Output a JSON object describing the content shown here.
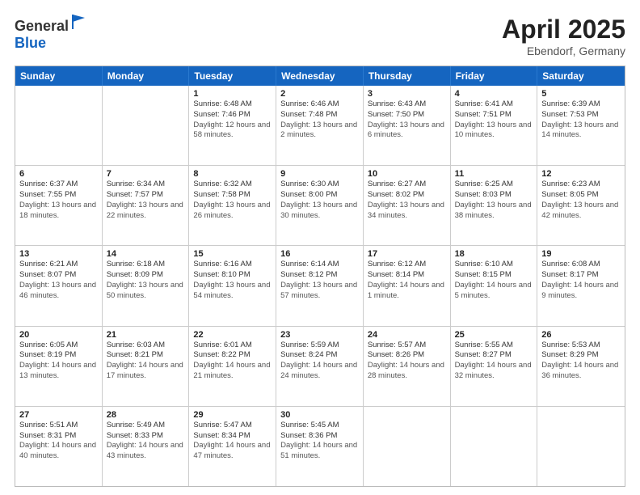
{
  "header": {
    "logo_general": "General",
    "logo_blue": "Blue",
    "month": "April 2025",
    "location": "Ebendorf, Germany"
  },
  "weekdays": [
    "Sunday",
    "Monday",
    "Tuesday",
    "Wednesday",
    "Thursday",
    "Friday",
    "Saturday"
  ],
  "weeks": [
    [
      {
        "day": "",
        "sunrise": "",
        "sunset": "",
        "daylight": ""
      },
      {
        "day": "",
        "sunrise": "",
        "sunset": "",
        "daylight": ""
      },
      {
        "day": "1",
        "sunrise": "Sunrise: 6:48 AM",
        "sunset": "Sunset: 7:46 PM",
        "daylight": "Daylight: 12 hours and 58 minutes."
      },
      {
        "day": "2",
        "sunrise": "Sunrise: 6:46 AM",
        "sunset": "Sunset: 7:48 PM",
        "daylight": "Daylight: 13 hours and 2 minutes."
      },
      {
        "day": "3",
        "sunrise": "Sunrise: 6:43 AM",
        "sunset": "Sunset: 7:50 PM",
        "daylight": "Daylight: 13 hours and 6 minutes."
      },
      {
        "day": "4",
        "sunrise": "Sunrise: 6:41 AM",
        "sunset": "Sunset: 7:51 PM",
        "daylight": "Daylight: 13 hours and 10 minutes."
      },
      {
        "day": "5",
        "sunrise": "Sunrise: 6:39 AM",
        "sunset": "Sunset: 7:53 PM",
        "daylight": "Daylight: 13 hours and 14 minutes."
      }
    ],
    [
      {
        "day": "6",
        "sunrise": "Sunrise: 6:37 AM",
        "sunset": "Sunset: 7:55 PM",
        "daylight": "Daylight: 13 hours and 18 minutes."
      },
      {
        "day": "7",
        "sunrise": "Sunrise: 6:34 AM",
        "sunset": "Sunset: 7:57 PM",
        "daylight": "Daylight: 13 hours and 22 minutes."
      },
      {
        "day": "8",
        "sunrise": "Sunrise: 6:32 AM",
        "sunset": "Sunset: 7:58 PM",
        "daylight": "Daylight: 13 hours and 26 minutes."
      },
      {
        "day": "9",
        "sunrise": "Sunrise: 6:30 AM",
        "sunset": "Sunset: 8:00 PM",
        "daylight": "Daylight: 13 hours and 30 minutes."
      },
      {
        "day": "10",
        "sunrise": "Sunrise: 6:27 AM",
        "sunset": "Sunset: 8:02 PM",
        "daylight": "Daylight: 13 hours and 34 minutes."
      },
      {
        "day": "11",
        "sunrise": "Sunrise: 6:25 AM",
        "sunset": "Sunset: 8:03 PM",
        "daylight": "Daylight: 13 hours and 38 minutes."
      },
      {
        "day": "12",
        "sunrise": "Sunrise: 6:23 AM",
        "sunset": "Sunset: 8:05 PM",
        "daylight": "Daylight: 13 hours and 42 minutes."
      }
    ],
    [
      {
        "day": "13",
        "sunrise": "Sunrise: 6:21 AM",
        "sunset": "Sunset: 8:07 PM",
        "daylight": "Daylight: 13 hours and 46 minutes."
      },
      {
        "day": "14",
        "sunrise": "Sunrise: 6:18 AM",
        "sunset": "Sunset: 8:09 PM",
        "daylight": "Daylight: 13 hours and 50 minutes."
      },
      {
        "day": "15",
        "sunrise": "Sunrise: 6:16 AM",
        "sunset": "Sunset: 8:10 PM",
        "daylight": "Daylight: 13 hours and 54 minutes."
      },
      {
        "day": "16",
        "sunrise": "Sunrise: 6:14 AM",
        "sunset": "Sunset: 8:12 PM",
        "daylight": "Daylight: 13 hours and 57 minutes."
      },
      {
        "day": "17",
        "sunrise": "Sunrise: 6:12 AM",
        "sunset": "Sunset: 8:14 PM",
        "daylight": "Daylight: 14 hours and 1 minute."
      },
      {
        "day": "18",
        "sunrise": "Sunrise: 6:10 AM",
        "sunset": "Sunset: 8:15 PM",
        "daylight": "Daylight: 14 hours and 5 minutes."
      },
      {
        "day": "19",
        "sunrise": "Sunrise: 6:08 AM",
        "sunset": "Sunset: 8:17 PM",
        "daylight": "Daylight: 14 hours and 9 minutes."
      }
    ],
    [
      {
        "day": "20",
        "sunrise": "Sunrise: 6:05 AM",
        "sunset": "Sunset: 8:19 PM",
        "daylight": "Daylight: 14 hours and 13 minutes."
      },
      {
        "day": "21",
        "sunrise": "Sunrise: 6:03 AM",
        "sunset": "Sunset: 8:21 PM",
        "daylight": "Daylight: 14 hours and 17 minutes."
      },
      {
        "day": "22",
        "sunrise": "Sunrise: 6:01 AM",
        "sunset": "Sunset: 8:22 PM",
        "daylight": "Daylight: 14 hours and 21 minutes."
      },
      {
        "day": "23",
        "sunrise": "Sunrise: 5:59 AM",
        "sunset": "Sunset: 8:24 PM",
        "daylight": "Daylight: 14 hours and 24 minutes."
      },
      {
        "day": "24",
        "sunrise": "Sunrise: 5:57 AM",
        "sunset": "Sunset: 8:26 PM",
        "daylight": "Daylight: 14 hours and 28 minutes."
      },
      {
        "day": "25",
        "sunrise": "Sunrise: 5:55 AM",
        "sunset": "Sunset: 8:27 PM",
        "daylight": "Daylight: 14 hours and 32 minutes."
      },
      {
        "day": "26",
        "sunrise": "Sunrise: 5:53 AM",
        "sunset": "Sunset: 8:29 PM",
        "daylight": "Daylight: 14 hours and 36 minutes."
      }
    ],
    [
      {
        "day": "27",
        "sunrise": "Sunrise: 5:51 AM",
        "sunset": "Sunset: 8:31 PM",
        "daylight": "Daylight: 14 hours and 40 minutes."
      },
      {
        "day": "28",
        "sunrise": "Sunrise: 5:49 AM",
        "sunset": "Sunset: 8:33 PM",
        "daylight": "Daylight: 14 hours and 43 minutes."
      },
      {
        "day": "29",
        "sunrise": "Sunrise: 5:47 AM",
        "sunset": "Sunset: 8:34 PM",
        "daylight": "Daylight: 14 hours and 47 minutes."
      },
      {
        "day": "30",
        "sunrise": "Sunrise: 5:45 AM",
        "sunset": "Sunset: 8:36 PM",
        "daylight": "Daylight: 14 hours and 51 minutes."
      },
      {
        "day": "",
        "sunrise": "",
        "sunset": "",
        "daylight": ""
      },
      {
        "day": "",
        "sunrise": "",
        "sunset": "",
        "daylight": ""
      },
      {
        "day": "",
        "sunrise": "",
        "sunset": "",
        "daylight": ""
      }
    ]
  ]
}
